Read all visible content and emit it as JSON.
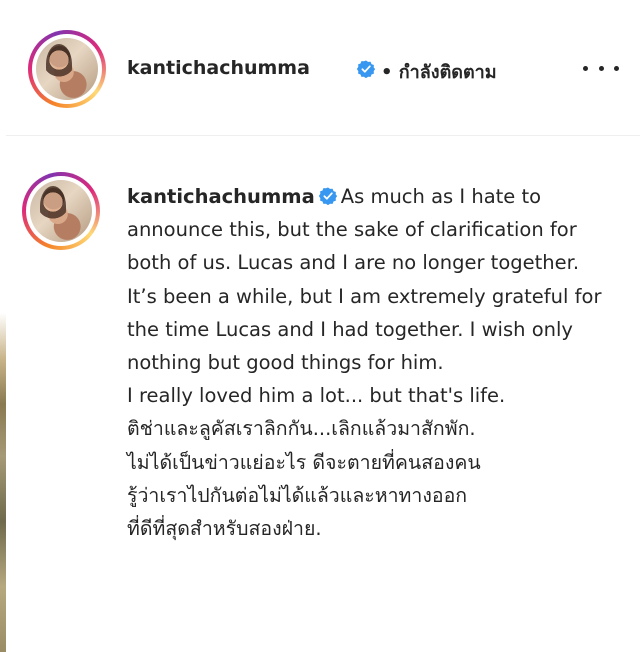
{
  "header": {
    "username": "kantichachumma",
    "follow_status": "• กำลังติดตาม",
    "more_icon": "more-horizontal-icon"
  },
  "post": {
    "username": "kantichachumma",
    "verified_icon": "verified-badge-icon",
    "caption_first": "As much as I hate to announce this, but the sake of clarification for both of us. Lucas and I are no longer together. It’s been a while, but I am extremely grateful for the time Lucas and I had together. I wish only nothing but good things for him.",
    "caption_lines": [
      "I really loved him a lot... but that's life.",
      "ติช่าและลูคัสเราลิกกัน...เลิกแล้วมาสักพัก.",
      "ไม่ได้เป็นข่าวแย่อะไร ดีจะตายที่คนสองคน",
      "รู้ว่าเราไปกันต่อไม่ได้แล้วและหาทางออก",
      "ที่ดีที่สุดสำหรับสองฝ่าย."
    ]
  },
  "colors": {
    "text": "#262626",
    "verified": "#3897f0",
    "divider": "#efefef"
  }
}
